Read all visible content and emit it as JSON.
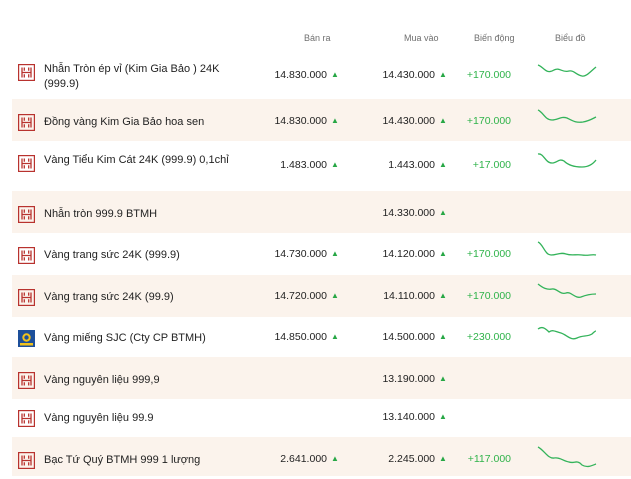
{
  "header": {
    "sell": "Bán ra",
    "buy": "Mua vào",
    "change": "Biến động",
    "chart": "Biểu đồ"
  },
  "colors": {
    "up": "#2fb34a",
    "row_alt": "#fbf3ec",
    "brand": "#b8322e"
  },
  "rows": [
    {
      "logo": "btmh-logo-icon",
      "name": "Nhẫn Tròn ép vỉ (Kim Gia Bảo ) 24K (999.9)",
      "sell": "14.830.000",
      "sell_arrow": "▲",
      "buy": "14.430.000",
      "buy_arrow": "▲",
      "change": "+170.000",
      "spark": true
    },
    {
      "logo": "btmh-logo-icon",
      "name": "Đồng vàng Kim Gia Bảo hoa sen",
      "sell": "14.830.000",
      "sell_arrow": "▲",
      "buy": "14.430.000",
      "buy_arrow": "▲",
      "change": "+170.000",
      "spark": true
    },
    {
      "logo": "btmh-logo-icon",
      "name": "Vàng Tiểu Kim Cát 24K (999.9) 0,1chỉ",
      "sell": "1.483.000",
      "sell_arrow": "▲",
      "buy": "1.443.000",
      "buy_arrow": "▲",
      "change": "+17.000",
      "spark": true
    },
    {
      "logo": "btmh-logo-icon",
      "name": "Nhẫn tròn 999.9 BTMH",
      "sell": "",
      "sell_arrow": "",
      "buy": "14.330.000",
      "buy_arrow": "▲",
      "change": "",
      "spark": false
    },
    {
      "logo": "btmh-logo-icon",
      "name": "Vàng trang sức 24K (999.9)",
      "sell": "14.730.000",
      "sell_arrow": "▲",
      "buy": "14.120.000",
      "buy_arrow": "▲",
      "change": "+170.000",
      "spark": true
    },
    {
      "logo": "btmh-logo-icon",
      "name": "Vàng trang sức 24K (99.9)",
      "sell": "14.720.000",
      "sell_arrow": "▲",
      "buy": "14.110.000",
      "buy_arrow": "▲",
      "change": "+170.000",
      "spark": true
    },
    {
      "logo": "sjc-logo-icon",
      "name": "Vàng miếng SJC (Cty CP BTMH)",
      "sell": "14.850.000",
      "sell_arrow": "▲",
      "buy": "14.500.000",
      "buy_arrow": "▲",
      "change": "+230.000",
      "spark": true
    },
    {
      "logo": "btmh-logo-icon",
      "name": "Vàng nguyên liệu 999,9",
      "sell": "",
      "sell_arrow": "",
      "buy": "13.190.000",
      "buy_arrow": "▲",
      "change": "",
      "spark": false
    },
    {
      "logo": "btmh-logo-icon",
      "name": "Vàng nguyên liệu 99.9",
      "sell": "",
      "sell_arrow": "",
      "buy": "13.140.000",
      "buy_arrow": "▲",
      "change": "",
      "spark": false
    },
    {
      "logo": "btmh-logo-icon",
      "name": "Bạc Tứ Quý BTMH 999 1 lượng",
      "sell": "2.641.000",
      "sell_arrow": "▲",
      "buy": "2.245.000",
      "buy_arrow": "▲",
      "change": "+117.000",
      "spark": true
    }
  ]
}
